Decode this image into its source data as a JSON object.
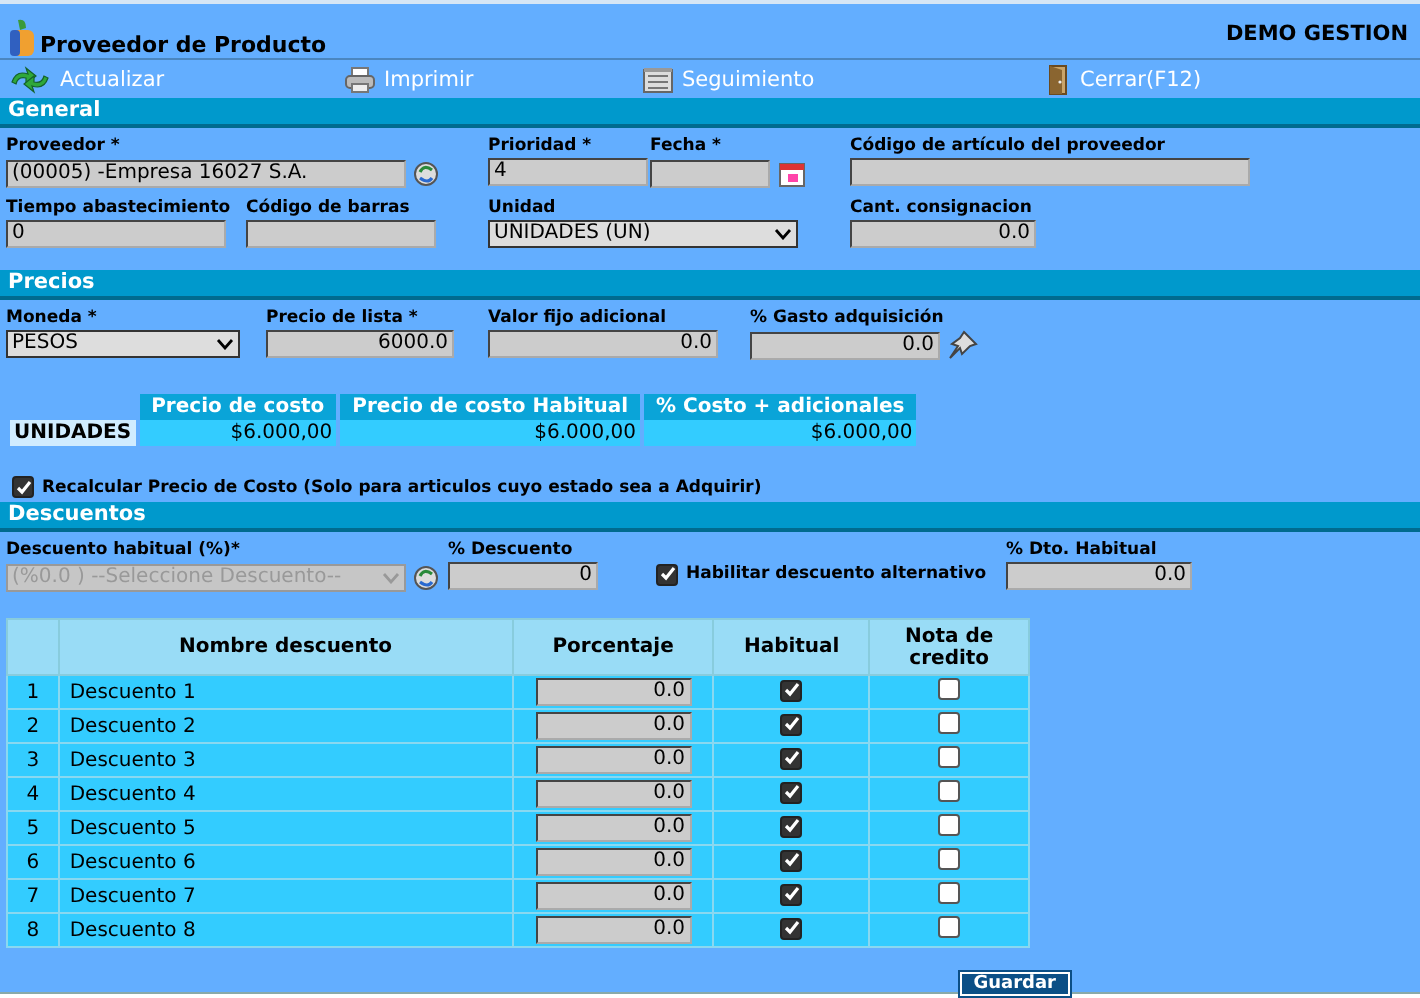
{
  "window": {
    "title": "Proveedor de Producto",
    "company": "DEMO GESTION"
  },
  "toolbar": [
    {
      "label": "Actualizar",
      "kind": "refresh"
    },
    {
      "label": "Imprimir",
      "kind": "print"
    },
    {
      "label": "Seguimiento",
      "kind": "track"
    },
    {
      "label": "Cerrar(F12)",
      "kind": "close"
    }
  ],
  "general": {
    "title": "General",
    "lines": [
      {
        "fields": [
          {
            "label": "Proveedor *",
            "value": "(00005) -Empresa 16027 S.A.",
            "kind": "text-lookup"
          },
          {
            "label": "Prioridad *",
            "value": "4",
            "kind": "text"
          },
          {
            "label": "Fecha *",
            "kind": "date"
          },
          {
            "label": "Código de artículo del proveedor",
            "kind": "text"
          }
        ]
      },
      {
        "fields": [
          {
            "label": "Tiempo abastecimiento",
            "value": "0",
            "kind": "text"
          },
          {
            "label": "Código de barras",
            "kind": "text"
          },
          {
            "label": "Unidad",
            "value": "UNIDADES (UN)",
            "kind": "select"
          },
          {
            "label": "Cant. consignacion",
            "value": "0.0",
            "kind": "number"
          }
        ]
      }
    ]
  },
  "precios": {
    "title": "Precios",
    "lines": [
      {
        "fields": [
          {
            "label": "Moneda *",
            "value": "PESOS",
            "kind": "select"
          },
          {
            "label": "Precio de lista *",
            "value": "6000.0",
            "kind": "number"
          },
          {
            "label": "Valor fijo adicional",
            "value": "0.0",
            "kind": "number"
          },
          {
            "label": "% Gasto adquisición",
            "value": "0.0",
            "kind": "number-calc"
          }
        ]
      }
    ],
    "cost_table": {
      "columns": [
        "Precio de costo",
        "Precio de costo Habitual",
        "% Costo + adicionales"
      ],
      "rows": [
        {
          "label": "UNIDADES",
          "cells": [
            "$6.000,00",
            "$6.000,00",
            "$6.000,00"
          ]
        }
      ]
    },
    "recalc": {
      "label": "Recalcular Precio de Costo (Solo para articulos cuyo estado sea a Adquirir)",
      "checked": true
    }
  },
  "descuentos": {
    "title": "Descuentos",
    "lines": [
      {
        "fields": [
          {
            "label": "Descuento habitual (%)*",
            "value": "(%0.0 ) --Seleccione Descuento--",
            "kind": "select-lookup",
            "disabled": true
          },
          {
            "label": "% Descuento",
            "value": "0",
            "kind": "number"
          },
          {
            "label": "Habilitar descuento alternativo",
            "kind": "checkbox",
            "checked": true
          },
          {
            "label": "% Dto. Habitual",
            "value": "0.0",
            "kind": "number"
          }
        ]
      }
    ],
    "table": {
      "columns": [
        "Nombre descuento",
        "Porcentaje",
        "Habitual",
        "Nota de credito"
      ],
      "rows": [
        {
          "number": "1",
          "name": "Descuento 1",
          "percent": "0.0",
          "habitual": true,
          "nota_credito": false
        },
        {
          "number": "2",
          "name": "Descuento 2",
          "percent": "0.0",
          "habitual": true,
          "nota_credito": false
        },
        {
          "number": "3",
          "name": "Descuento 3",
          "percent": "0.0",
          "habitual": true,
          "nota_credito": false
        },
        {
          "number": "4",
          "name": "Descuento 4",
          "percent": "0.0",
          "habitual": true,
          "nota_credito": false
        },
        {
          "number": "5",
          "name": "Descuento 5",
          "percent": "0.0",
          "habitual": true,
          "nota_credito": false
        },
        {
          "number": "6",
          "name": "Descuento 6",
          "percent": "0.0",
          "habitual": true,
          "nota_credito": false
        },
        {
          "number": "7",
          "name": "Descuento 7",
          "percent": "0.0",
          "habitual": true,
          "nota_credito": false
        },
        {
          "number": "8",
          "name": "Descuento 8",
          "percent": "0.0",
          "habitual": true,
          "nota_credito": false
        }
      ]
    }
  },
  "save_button": "Guardar"
}
